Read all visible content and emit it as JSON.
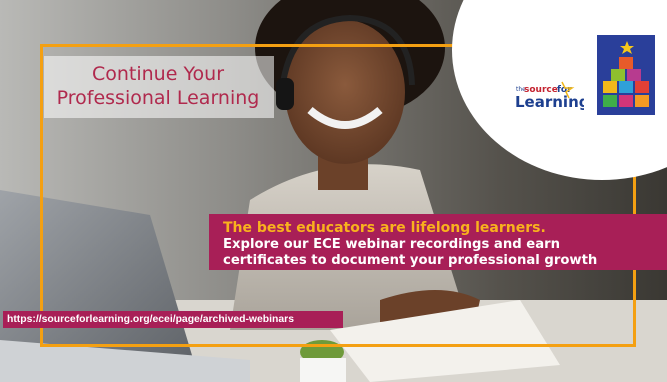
{
  "slide": {
    "title_line1": "Continue Your",
    "title_line2": "Professional Learning",
    "tagline": "The best educators are lifelong learners.",
    "body_line1": "Explore our ECE webinar recordings and earn",
    "body_line2": "certificates to document your professional growth",
    "url": "https://sourceforlearning.org/ecei/page/archived-webinars"
  },
  "logo": {
    "text_the": "the",
    "text_source": "source",
    "text_for": "for",
    "text_learning": "Learning",
    "icon": "source-for-learning-logo"
  },
  "colors": {
    "accent_orange": "#f4a012",
    "brand_magenta": "#a81f57",
    "title_red": "#b0294d",
    "tagline_yellow": "#f9b21d"
  }
}
